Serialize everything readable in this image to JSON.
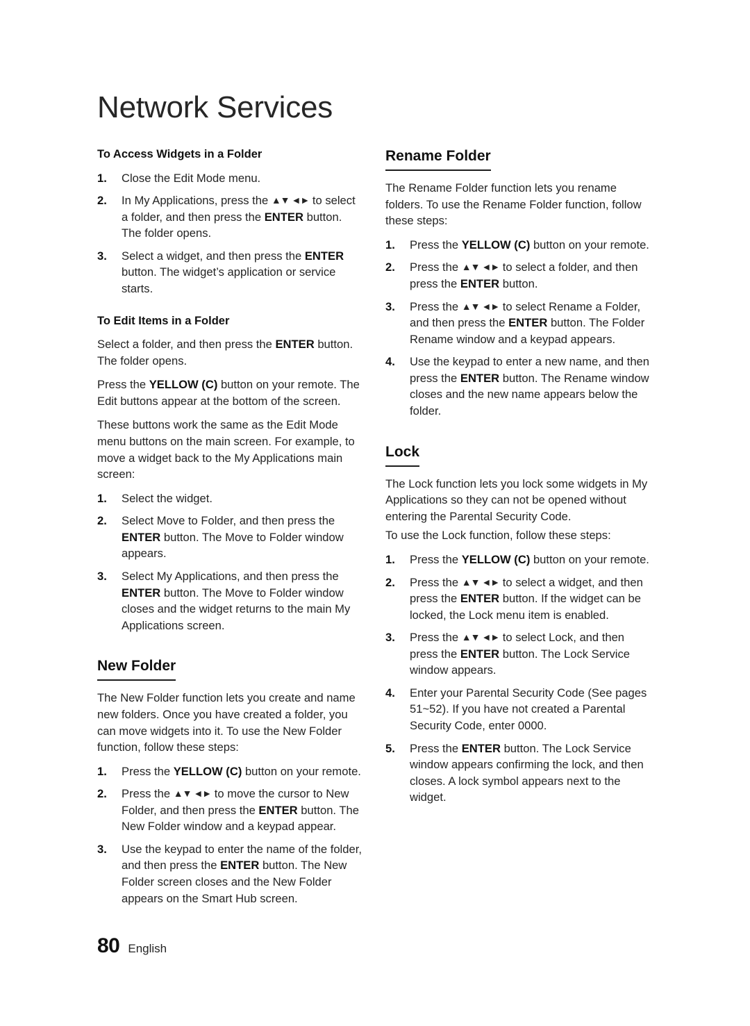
{
  "page": {
    "chapter_title": "Network Services",
    "footer": {
      "page_number": "80",
      "language": "English"
    }
  },
  "arrows_glyph": "▲▼◄►",
  "left_column": {
    "section_access": {
      "heading": "To Access Widgets in a Folder",
      "steps": [
        {
          "num": "1.",
          "parts": [
            {
              "t": "Close the Edit Mode menu.",
              "b": false
            }
          ]
        },
        {
          "num": "2.",
          "parts": [
            {
              "t": "In My Applications, press the ",
              "b": false
            },
            {
              "t": "ARROWS",
              "b": false,
              "arrows": true
            },
            {
              "t": " to select a folder, and then press the ",
              "b": false
            },
            {
              "t": "ENTER",
              "b": true
            },
            {
              "t": " button. The folder opens.",
              "b": false
            }
          ]
        },
        {
          "num": "3.",
          "parts": [
            {
              "t": "Select a widget, and then press the ",
              "b": false
            },
            {
              "t": "ENTER",
              "b": true
            },
            {
              "t": " button. The widget’s application or service starts.",
              "b": false
            }
          ]
        }
      ]
    },
    "section_edit": {
      "heading": "To Edit Items in a Folder",
      "paragraphs": [
        {
          "parts": [
            {
              "t": "Select a folder, and then press the ",
              "b": false
            },
            {
              "t": "ENTER",
              "b": true
            },
            {
              "t": " button. The folder opens.",
              "b": false
            }
          ]
        },
        {
          "parts": [
            {
              "t": "Press the ",
              "b": false
            },
            {
              "t": "YELLOW (C)",
              "b": true
            },
            {
              "t": " button on your remote. The Edit buttons appear at the bottom of the screen.",
              "b": false
            }
          ]
        },
        {
          "parts": [
            {
              "t": "These buttons work the same as the Edit Mode menu buttons on the main screen. For example, to move a widget back to the My Applications main screen:",
              "b": false
            }
          ]
        }
      ],
      "steps": [
        {
          "num": "1.",
          "parts": [
            {
              "t": "Select the widget.",
              "b": false
            }
          ]
        },
        {
          "num": "2.",
          "parts": [
            {
              "t": "Select Move to Folder, and then press the ",
              "b": false
            },
            {
              "t": "ENTER",
              "b": true
            },
            {
              "t": " button. The Move to Folder window appears.",
              "b": false
            }
          ]
        },
        {
          "num": "3.",
          "parts": [
            {
              "t": "Select My Applications, and then press the ",
              "b": false
            },
            {
              "t": "ENTER",
              "b": true
            },
            {
              "t": " button. The Move to Folder window closes and the widget returns to the main My Applications screen.",
              "b": false
            }
          ]
        }
      ]
    },
    "section_new_folder": {
      "heading": "New Folder",
      "intro": {
        "parts": [
          {
            "t": "The New Folder function lets you create and name new folders. Once you have created a folder, you can move widgets into it. To use the New Folder function, follow these steps:",
            "b": false
          }
        ]
      },
      "steps": [
        {
          "num": "1.",
          "parts": [
            {
              "t": "Press the ",
              "b": false
            },
            {
              "t": "YELLOW (C)",
              "b": true
            },
            {
              "t": " button on your remote.",
              "b": false
            }
          ]
        },
        {
          "num": "2.",
          "parts": [
            {
              "t": "Press the ",
              "b": false
            },
            {
              "t": "ARROWS",
              "b": false,
              "arrows": true
            },
            {
              "t": " to move the cursor to New Folder, and then press the ",
              "b": false
            },
            {
              "t": "ENTER",
              "b": true
            },
            {
              "t": " button. The New Folder window and a keypad appear.",
              "b": false
            }
          ]
        },
        {
          "num": "3.",
          "parts": [
            {
              "t": "Use the keypad to enter the name of the folder, and then press the ",
              "b": false
            },
            {
              "t": "ENTER",
              "b": true
            },
            {
              "t": " button. The New Folder screen closes and the New Folder appears on the Smart Hub screen.",
              "b": false
            }
          ]
        }
      ]
    }
  },
  "right_column": {
    "section_rename": {
      "heading": "Rename Folder",
      "intro": {
        "parts": [
          {
            "t": "The Rename Folder function lets you rename folders. To use the Rename Folder function, follow these steps:",
            "b": false
          }
        ]
      },
      "steps": [
        {
          "num": "1.",
          "parts": [
            {
              "t": "Press the ",
              "b": false
            },
            {
              "t": "YELLOW (C)",
              "b": true
            },
            {
              "t": " button on your remote.",
              "b": false
            }
          ]
        },
        {
          "num": "2.",
          "parts": [
            {
              "t": "Press the ",
              "b": false
            },
            {
              "t": "ARROWS",
              "b": false,
              "arrows": true
            },
            {
              "t": " to select a folder, and then press the ",
              "b": false
            },
            {
              "t": "ENTER",
              "b": true
            },
            {
              "t": " button.",
              "b": false
            }
          ]
        },
        {
          "num": "3.",
          "parts": [
            {
              "t": "Press the ",
              "b": false
            },
            {
              "t": "ARROWS",
              "b": false,
              "arrows": true
            },
            {
              "t": " to select Rename a Folder, and then press the ",
              "b": false
            },
            {
              "t": "ENTER",
              "b": true
            },
            {
              "t": " button. The Folder Rename window and a keypad appears.",
              "b": false
            }
          ]
        },
        {
          "num": "4.",
          "parts": [
            {
              "t": "Use the keypad to enter a new name, and then press the ",
              "b": false
            },
            {
              "t": "ENTER",
              "b": true
            },
            {
              "t": " button. The Rename window closes and the new name appears below the folder.",
              "b": false
            }
          ]
        }
      ]
    },
    "section_lock": {
      "heading": "Lock",
      "intro": {
        "parts": [
          {
            "t": "The Lock function lets you lock some widgets in My Applications so they can not be opened without entering the Parental Security Code.",
            "b": false
          }
        ]
      },
      "intro2": {
        "parts": [
          {
            "t": "To use the Lock function, follow these steps:",
            "b": false
          }
        ]
      },
      "steps": [
        {
          "num": "1.",
          "parts": [
            {
              "t": "Press the ",
              "b": false
            },
            {
              "t": "YELLOW (C)",
              "b": true
            },
            {
              "t": " button on your remote.",
              "b": false
            }
          ]
        },
        {
          "num": "2.",
          "parts": [
            {
              "t": "Press the ",
              "b": false
            },
            {
              "t": "ARROWS",
              "b": false,
              "arrows": true
            },
            {
              "t": " to select a widget, and then press the ",
              "b": false
            },
            {
              "t": "ENTER",
              "b": true
            },
            {
              "t": " button. If the widget can be locked, the Lock menu item is enabled.",
              "b": false
            }
          ]
        },
        {
          "num": "3.",
          "parts": [
            {
              "t": "Press the ",
              "b": false
            },
            {
              "t": "ARROWS",
              "b": false,
              "arrows": true
            },
            {
              "t": " to select Lock, and then press the ",
              "b": false
            },
            {
              "t": "ENTER",
              "b": true
            },
            {
              "t": " button. The Lock Service window appears.",
              "b": false
            }
          ]
        },
        {
          "num": "4.",
          "parts": [
            {
              "t": "Enter your Parental Security Code (See pages 51~52). If you have not created a Parental Security Code, enter 0000.",
              "b": false
            }
          ]
        },
        {
          "num": "5.",
          "parts": [
            {
              "t": "Press the ",
              "b": false
            },
            {
              "t": "ENTER",
              "b": true
            },
            {
              "t": " button. The Lock Service window appears confirming the lock, and then closes. A lock symbol appears next to the widget.",
              "b": false
            }
          ]
        }
      ]
    }
  }
}
